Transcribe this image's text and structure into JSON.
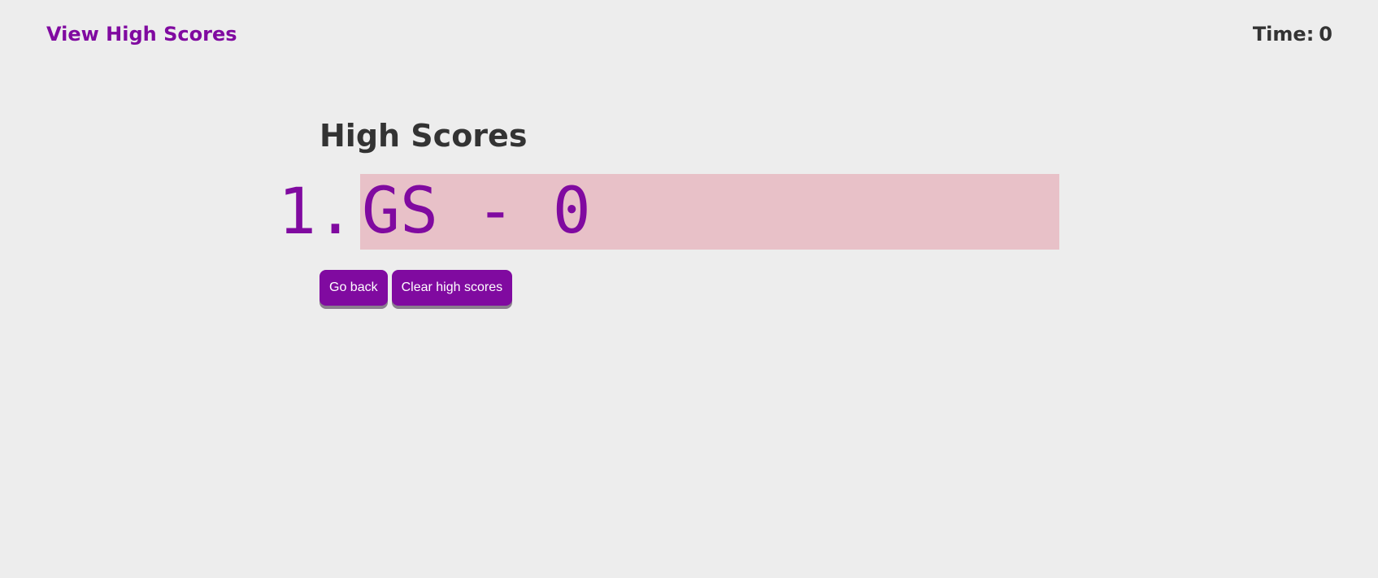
{
  "header": {
    "view_scores_label": "View High Scores",
    "timer_label": "Time:",
    "timer_value": "0"
  },
  "main": {
    "title": "High Scores",
    "scores": [
      {
        "rank": "1.",
        "text": "GS - 0"
      }
    ],
    "buttons": {
      "go_back_label": "Go back",
      "clear_label": "Clear high scores"
    }
  },
  "colors": {
    "accent": "#800aa0",
    "text": "#333333",
    "background": "#ededed",
    "score_highlight": "#e8c1c8",
    "button_shadow": "#8a7e8e"
  }
}
